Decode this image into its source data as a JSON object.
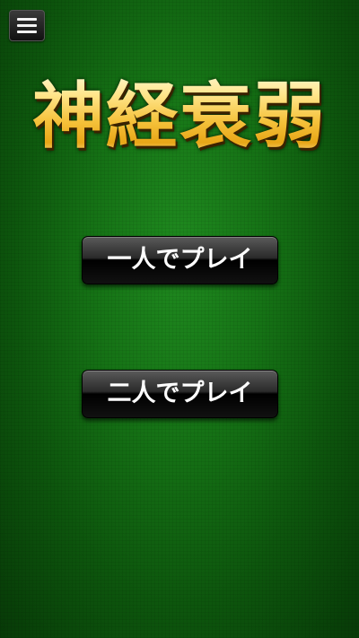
{
  "menu": {
    "icon": "hamburger-menu-icon"
  },
  "title": "神経衰弱",
  "buttons": {
    "one_player": "一人でプレイ",
    "two_player": "二人でプレイ"
  },
  "colors": {
    "background": "#157215",
    "title_gold": "#f5c23c",
    "button_bg": "#1a1a1a",
    "button_text": "#ffffff"
  }
}
